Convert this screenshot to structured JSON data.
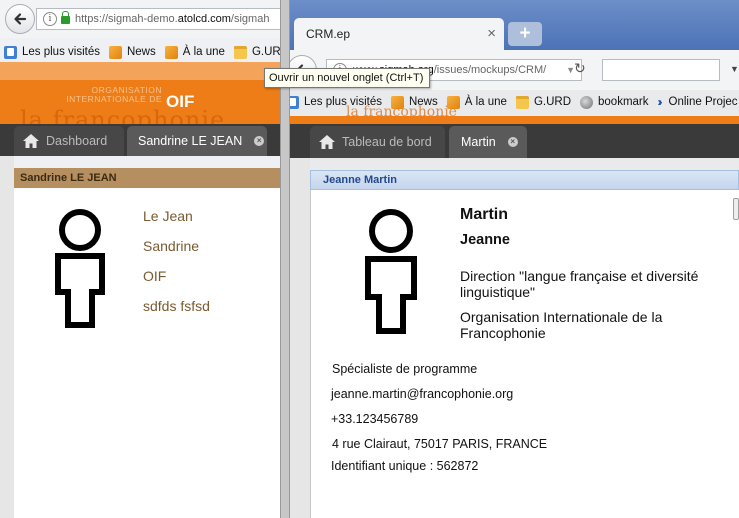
{
  "left_window": {
    "url_prefix": "https://sigmah-demo.",
    "url_domain": "atolcd.com",
    "url_suffix": "/sigmah",
    "bookmarks": [
      {
        "label": "Les plus visités",
        "icon": "bookmark-star-icon"
      },
      {
        "label": "News",
        "icon": "rss-icon"
      },
      {
        "label": "À la une",
        "icon": "rss-icon"
      },
      {
        "label": "G.URD",
        "icon": "folder-icon"
      }
    ],
    "banner": {
      "org_line1": "ORGANISATION",
      "org_line2": "INTERNATIONALE DE",
      "acronym": "OIF",
      "ghost_text": "la francophonie"
    },
    "tabs": [
      {
        "label": "Dashboard"
      },
      {
        "label": "Sandrine LE JEAN"
      }
    ],
    "header": "Sandrine LE JEAN",
    "fields": [
      "Le Jean",
      "Sandrine",
      "OIF",
      "sdfds fsfsd"
    ]
  },
  "right_window": {
    "tab_title": "CRM.ep",
    "url_prefix": "www.",
    "url_domain": "sigmah.org",
    "url_suffix": "/issues/mockups/CRM/",
    "tooltip": "Ouvrir un nouvel onglet (Ctrl+T)",
    "bookmarks": [
      {
        "label": "Les plus visités",
        "icon": "bookmark-star-icon"
      },
      {
        "label": "News",
        "icon": "rss-icon"
      },
      {
        "label": "À la une",
        "icon": "rss-icon"
      },
      {
        "label": "G.URD",
        "icon": "folder-icon"
      },
      {
        "label": "bookmark",
        "icon": "globe-icon"
      },
      {
        "label": "Online Projec",
        "icon": "double-chevron-icon"
      }
    ],
    "ghost_text": "la francophonie",
    "tabs": [
      {
        "label": "Tableau de bord"
      },
      {
        "label": "Martin"
      }
    ],
    "header": "Jeanne Martin",
    "contact": {
      "last_name": "Martin",
      "first_name": "Jeanne",
      "direction": "Direction \"langue française et diversité linguistique\"",
      "organization": "Organisation Internationale de la Francophonie",
      "role": "Spécialiste de programme",
      "email": "jeanne.martin@francophonie.org",
      "phone": "+33.123456789",
      "address": "4 rue Clairaut, 75017 PARIS, FRANCE",
      "unique_id": "Identifiant unique : 562872"
    }
  }
}
